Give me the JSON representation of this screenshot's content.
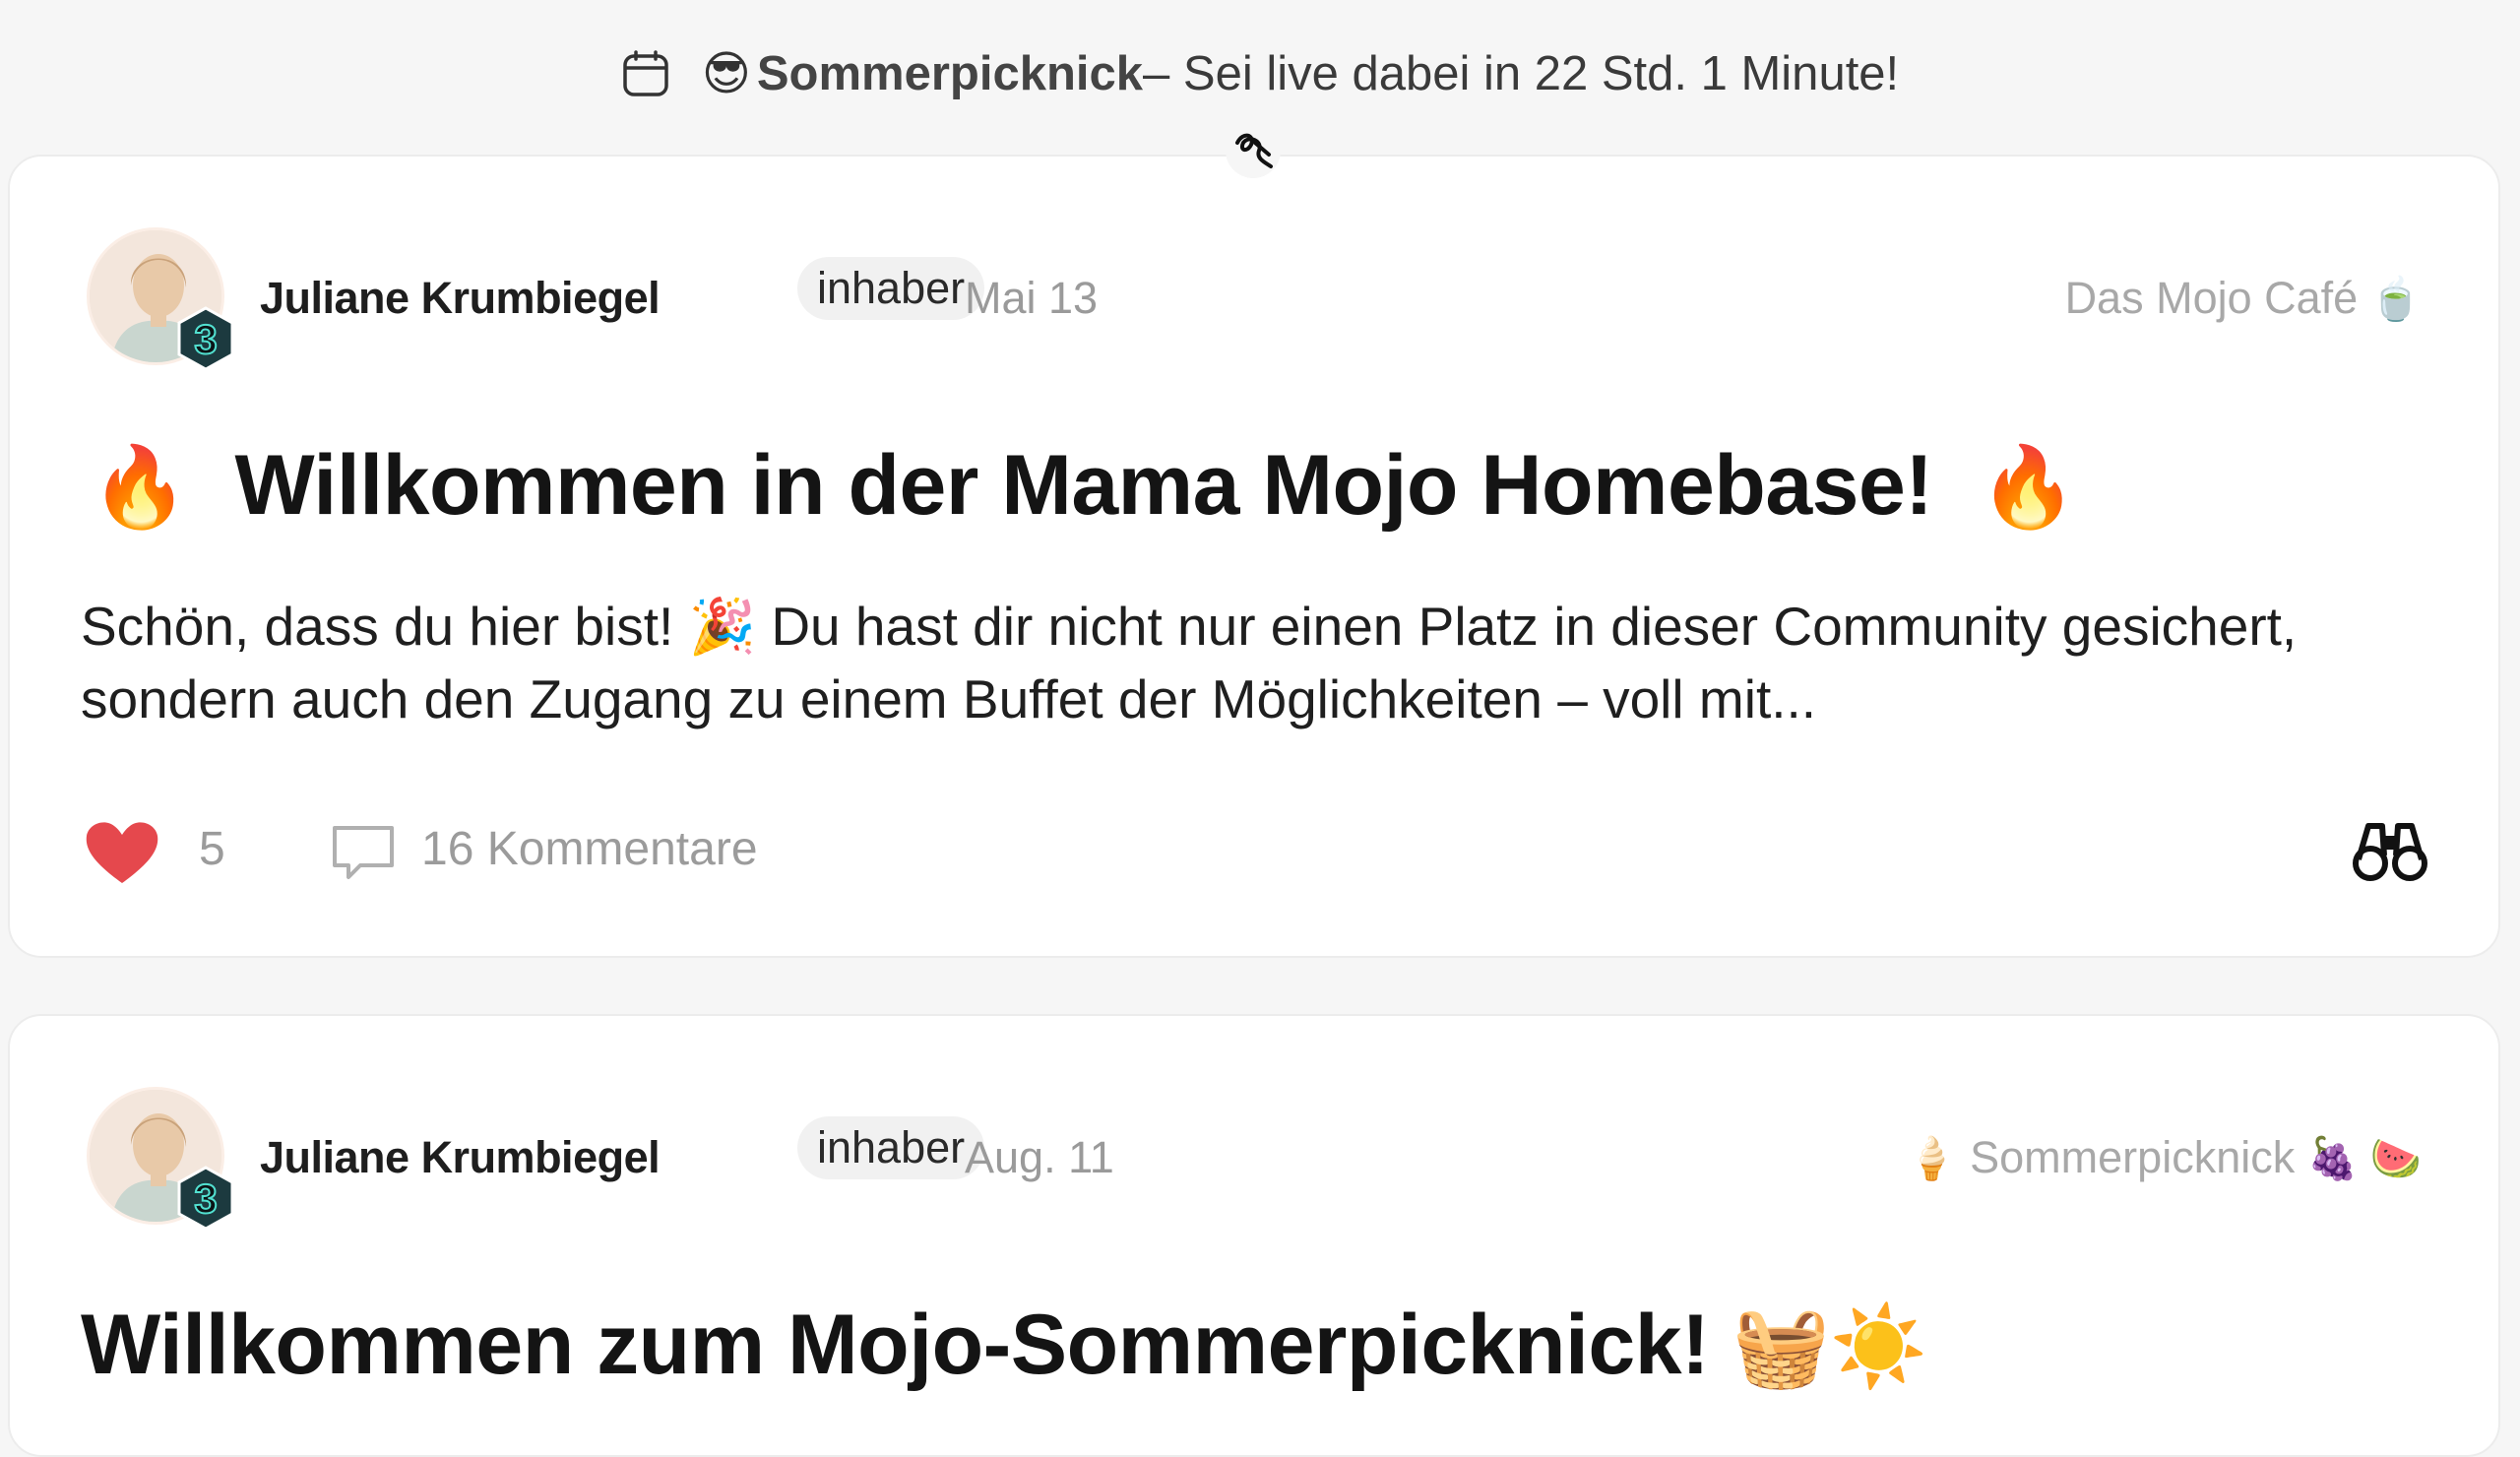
{
  "banner": {
    "calendar_icon": "calendar-icon",
    "emoji": "😎",
    "event_name": "Sommerpicknick",
    "countdown_text": " – Sei live dabei in 22 Std. 1 Minute!"
  },
  "posts": [
    {
      "author": "Juliane Krumbiegel",
      "level": "3",
      "role": "inhaber",
      "date": "Mai 13",
      "space": "Das Mojo Café",
      "space_emoji": "🍵",
      "title_prefix_emoji": "🔥",
      "title": "Willkommen in der Mama Mojo Homebase!",
      "title_suffix_emoji": "🔥",
      "excerpt": "Schön, dass du hier bist! 🎉 Du hast dir nicht nur einen Platz in dieser Community gesichert, sondern auch den Zugang zu einem Buffet der Möglichkeiten – voll mit...",
      "likes": "5",
      "comments": "16 Kommentare"
    },
    {
      "author": "Juliane Krumbiegel",
      "level": "3",
      "role": "inhaber",
      "date": "Aug. 11",
      "space_emoji_prefix": "🍦",
      "space": "Sommerpicknick",
      "space_emoji": "🍇 🍉",
      "title": "Willkommen zum Mojo-Sommerpicknick!",
      "title_suffix_emoji": "🧺☀️"
    }
  ],
  "colors": {
    "background": "#f6f6f6",
    "card": "#ffffff",
    "heart": "#e5484d",
    "muted": "#9b9b9b",
    "badge": "#1c3a3f"
  }
}
